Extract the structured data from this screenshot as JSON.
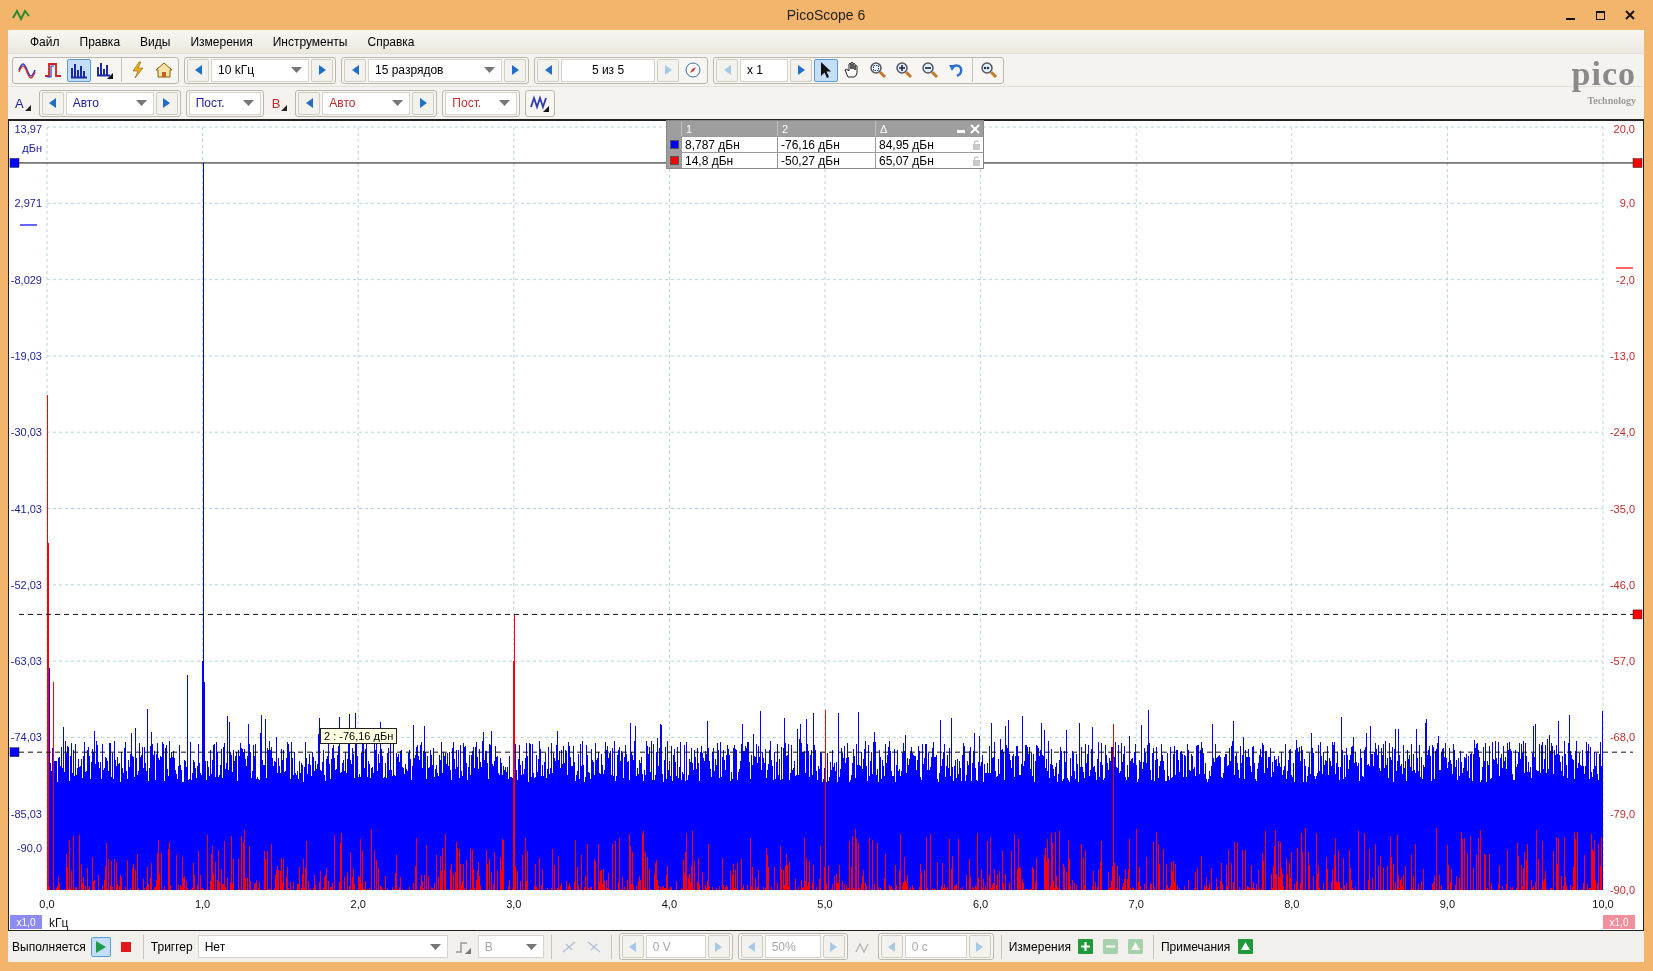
{
  "window": {
    "title": "PicoScope 6"
  },
  "menu": [
    "Файл",
    "Правка",
    "Виды",
    "Измерения",
    "Инструменты",
    "Справка"
  ],
  "toolbar": {
    "modes": [
      {
        "kind": "scope",
        "selected": false
      },
      {
        "kind": "persistence",
        "selected": false
      },
      {
        "kind": "spectrum",
        "selected": true
      },
      {
        "kind": "spectrum_multi",
        "selected": false
      }
    ],
    "span": "10 kГц",
    "resolution": "15 разрядов",
    "buffer": "5 из 5",
    "zoom": "x 1",
    "tools": [
      {
        "kind": "pointer",
        "selected": true
      },
      {
        "kind": "hand",
        "selected": false
      },
      {
        "kind": "zoom_area",
        "selected": false
      },
      {
        "kind": "zoom_in",
        "selected": false
      },
      {
        "kind": "zoom_out",
        "selected": false
      },
      {
        "kind": "undo",
        "selected": false
      },
      {
        "kind": "zoom_full",
        "selected": false
      }
    ]
  },
  "logo": {
    "name": "pico",
    "tagline": "Technology"
  },
  "channels": [
    {
      "label": "A",
      "color": "#1c1c9c",
      "range": "Авто",
      "coupling": "Пост."
    },
    {
      "label": "B",
      "color": "#c42b2b",
      "range": "Авто",
      "coupling": "Пост."
    }
  ],
  "measurements_table": {
    "columns": [
      "1",
      "2",
      "Δ"
    ],
    "rows": [
      {
        "color": "#0000ff",
        "cells": [
          "8,787 дБн",
          "-76,16 дБн",
          "84,95 дБн"
        ]
      },
      {
        "color": "#ff0000",
        "cells": [
          "14,8 дБн",
          "-50,27 дБн",
          "65,07 дБн"
        ]
      }
    ]
  },
  "plot": {
    "left_axis": {
      "ticks": [
        "13,97",
        "2,971",
        "-8,029",
        "-19,03",
        "-30,03",
        "-41,03",
        "-52,03",
        "-63,03",
        "-74,03",
        "-85,03",
        "-90,0"
      ],
      "unit": "дБн",
      "scale": "x1,0"
    },
    "right_axis": {
      "ticks": [
        "20,0",
        "9,0",
        "-2,0",
        "-13,0",
        "-24,0",
        "-35,0",
        "-46,0",
        "-57,0",
        "-68,0",
        "-79,0",
        "-90,0"
      ],
      "scale": "x1,0"
    },
    "x_axis": {
      "ticks": [
        "0,0",
        "1,0",
        "2,0",
        "3,0",
        "4,0",
        "5,0",
        "6,0",
        "7,0",
        "8,0",
        "9,0",
        "10,0"
      ],
      "unit": "kГц"
    },
    "ruler_tooltip": "2 : -76,16 дБн"
  },
  "status_bar": {
    "run_status": "Выполняется",
    "run_selected": true,
    "trigger_label": "Триггер",
    "trigger_mode": "Нет",
    "trigger_source": {
      "value": "B",
      "disabled": true
    },
    "threshold": {
      "value": "0 V",
      "disabled": true
    },
    "pretrigger": {
      "value": "50%",
      "disabled": true
    },
    "delay": {
      "value": "0 с",
      "disabled": true
    },
    "measurements_label": "Измерения",
    "measure_buttons": [
      {
        "kind": "add",
        "disabled": false
      },
      {
        "kind": "remove",
        "disabled": true
      },
      {
        "kind": "edit",
        "disabled": true
      }
    ],
    "notes_label": "Примечания"
  }
}
